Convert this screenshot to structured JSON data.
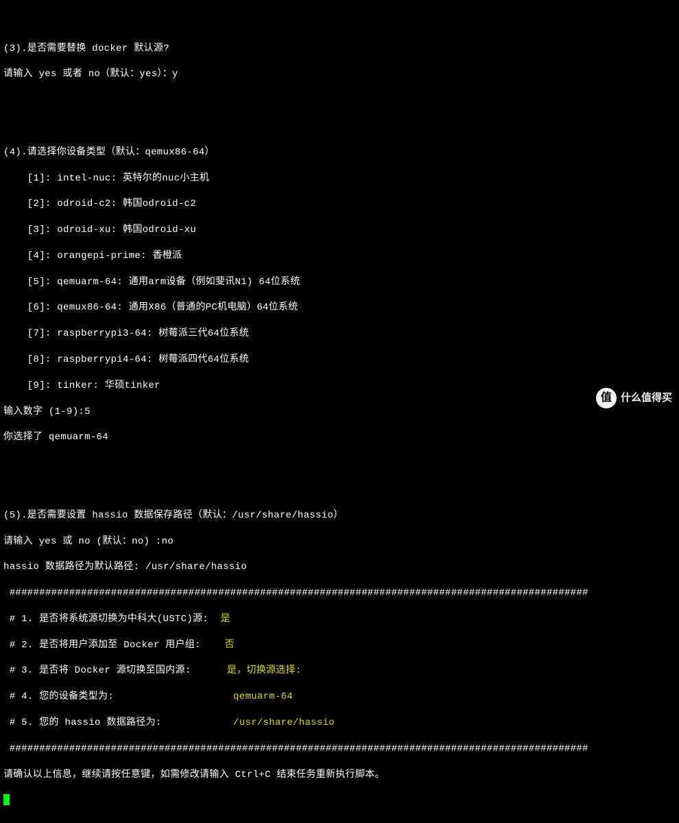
{
  "q3": {
    "title": "(3).是否需要替换 docker 默认源?",
    "prompt": "请输入 yes 或者 no（默认：yes）：y"
  },
  "q4": {
    "title": "(4).请选择你设备类型（默认：qemux86-64）",
    "options": [
      "    [1]: intel-nuc: 英特尔的nuc小主机",
      "    [2]: odroid-c2: 韩国odroid-c2",
      "    [3]: odroid-xu: 韩国odroid-xu",
      "    [4]: orangepi-prime: 香橙派",
      "    [5]: qemuarm-64: 通用arm设备（例如斐讯N1) 64位系统",
      "    [6]: qemux86-64: 通用X86（普通的PC机电脑）64位系统",
      "    [7]: raspberrypi3-64: 树莓派三代64位系统",
      "    [8]: raspberrypi4-64: 树莓派四代64位系统",
      "    [9]: tinker: 华硕tinker"
    ],
    "input_prompt": "输入数字 (1-9):5",
    "result": "你选择了 qemuarm-64"
  },
  "q5": {
    "title": "(5).是否需要设置 hassio 数据保存路径（默认：/usr/share/hassio）",
    "prompt": "请输入 yes 或 no (默认：no) :no",
    "result": "hassio 数据路径为默认路径: /usr/share/hassio"
  },
  "divider": " #################################################################################################",
  "summary": [
    {
      "label": " # 1. 是否将系统源切换为中科大(USTC)源:",
      "pad": "  ",
      "value": "是"
    },
    {
      "label": " # 2. 是否将用户添加至 Docker 用户组:",
      "pad": "    ",
      "value": "否"
    },
    {
      "label": " # 3. 是否将 Docker 源切换至国内源:",
      "pad": "      ",
      "value": "是，切换源选择:"
    },
    {
      "label": " # 4. 您的设备类型为:",
      "pad": "                    ",
      "value": "qemuarm-64"
    },
    {
      "label": " # 5. 您的 hassio 数据路径为:",
      "pad": "            ",
      "value": "/usr/share/hassio"
    }
  ],
  "confirm": "请确认以上信息，继续请按任意键，如需修改请输入 Ctrl+C 结束任务重新执行脚本。",
  "watermark": {
    "icon": "值",
    "text": "什么值得买"
  }
}
